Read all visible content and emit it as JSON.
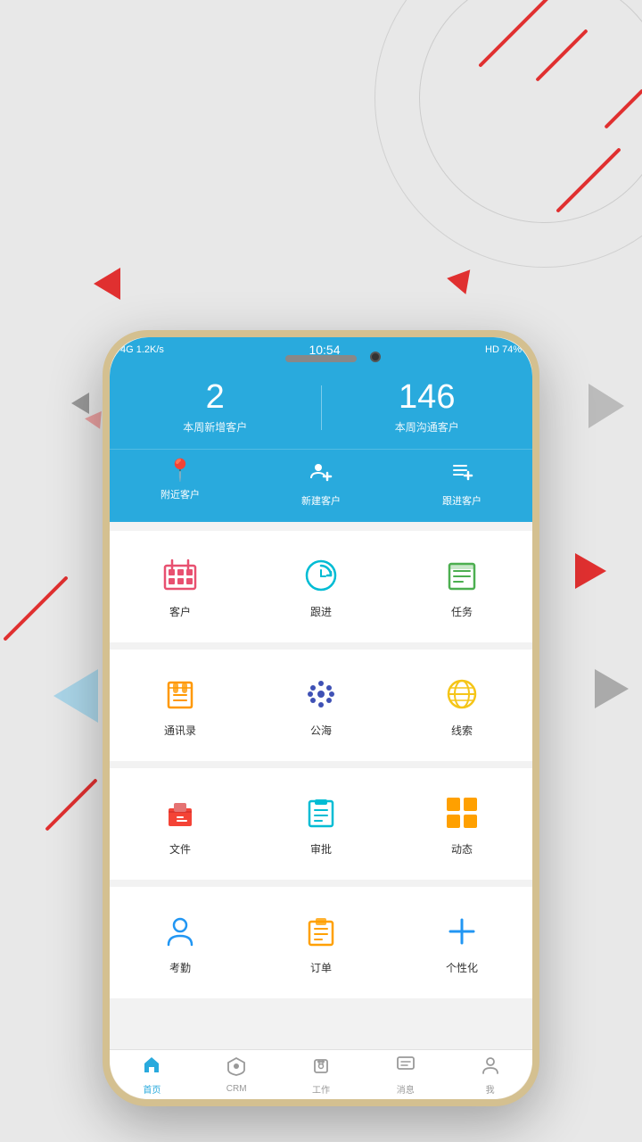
{
  "background": {
    "color": "#e8e8e8"
  },
  "status_bar": {
    "left_text": "4G  1.2K/s",
    "time": "10:54",
    "right_text": "HD  74%"
  },
  "header": {
    "stat1_number": "2",
    "stat1_label": "本周新增客户",
    "stat2_number": "146",
    "stat2_label": "本周沟通客户"
  },
  "quick_actions": [
    {
      "id": "nearby",
      "label": "附近客户",
      "icon": "📍"
    },
    {
      "id": "new",
      "label": "新建客户",
      "icon": "👥"
    },
    {
      "id": "follow",
      "label": "跟进客户",
      "icon": "📋"
    }
  ],
  "grid_rows": [
    {
      "id": "row1",
      "items": [
        {
          "id": "customer",
          "label": "客户",
          "icon": "🏢",
          "color": "icon-pink"
        },
        {
          "id": "followup",
          "label": "跟进",
          "icon": "🔄",
          "color": "icon-teal"
        },
        {
          "id": "task",
          "label": "任务",
          "icon": "📋",
          "color": "icon-green"
        }
      ]
    },
    {
      "id": "row2",
      "items": [
        {
          "id": "contacts",
          "label": "通讯录",
          "icon": "📖",
          "color": "icon-orange"
        },
        {
          "id": "public",
          "label": "公海",
          "icon": "⠿",
          "color": "icon-indigo"
        },
        {
          "id": "leads",
          "label": "线索",
          "icon": "🌐",
          "color": "icon-yellow"
        }
      ]
    },
    {
      "id": "row3",
      "items": [
        {
          "id": "files",
          "label": "文件",
          "icon": "💼",
          "color": "icon-red"
        },
        {
          "id": "approve",
          "label": "审批",
          "icon": "📅",
          "color": "icon-teal"
        },
        {
          "id": "dynamic",
          "label": "动态",
          "icon": "▦",
          "color": "icon-amber"
        }
      ]
    },
    {
      "id": "row4",
      "items": [
        {
          "id": "attendance",
          "label": "考勤",
          "icon": "👤",
          "color": "icon-blue"
        },
        {
          "id": "order",
          "label": "订单",
          "icon": "📝",
          "color": "icon-amber"
        },
        {
          "id": "customize",
          "label": "个性化",
          "icon": "➕",
          "color": "icon-blue"
        }
      ]
    }
  ],
  "nav": {
    "items": [
      {
        "id": "home",
        "label": "首页",
        "icon": "🏠",
        "active": true
      },
      {
        "id": "crm",
        "label": "CRM",
        "icon": "🛡",
        "active": false
      },
      {
        "id": "work",
        "label": "工作",
        "icon": "🔒",
        "active": false
      },
      {
        "id": "message",
        "label": "消息",
        "icon": "💬",
        "active": false
      },
      {
        "id": "me",
        "label": "我",
        "icon": "👤",
        "active": false
      }
    ]
  }
}
